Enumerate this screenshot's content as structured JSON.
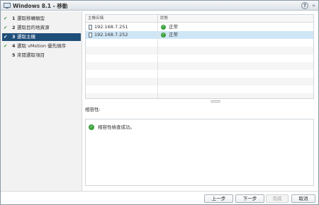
{
  "window": {
    "title": "Windows 8.1 - 移動",
    "help_glyph": "?",
    "expand_glyph": "»"
  },
  "steps": [
    {
      "num": "1",
      "label": "選取移轉類型",
      "done": true,
      "active": false
    },
    {
      "num": "2",
      "label": "選取目的地資源",
      "done": true,
      "active": false
    },
    {
      "num": "3",
      "label": "選取主機",
      "done": true,
      "active": true
    },
    {
      "num": "4",
      "label": "選取 vMotion 優先順序",
      "done": true,
      "active": false
    },
    {
      "num": "5",
      "label": "來閱選取項目",
      "done": false,
      "active": false
    }
  ],
  "hosts_table": {
    "columns": [
      "主機名稱",
      "狀態"
    ],
    "rows": [
      {
        "host": "192.168.7.251",
        "status": "正常",
        "selected": false
      },
      {
        "host": "192.168.7.252",
        "status": "正常",
        "selected": true
      }
    ]
  },
  "compatibility": {
    "label": "相容性:",
    "message": "相容性檢查成功。"
  },
  "buttons": {
    "back": "上一步",
    "next": "下一步",
    "finish": "完成",
    "cancel": "取消"
  },
  "icons": {
    "title_icon": "vm-icon",
    "check": "✔",
    "ok": "✓"
  }
}
